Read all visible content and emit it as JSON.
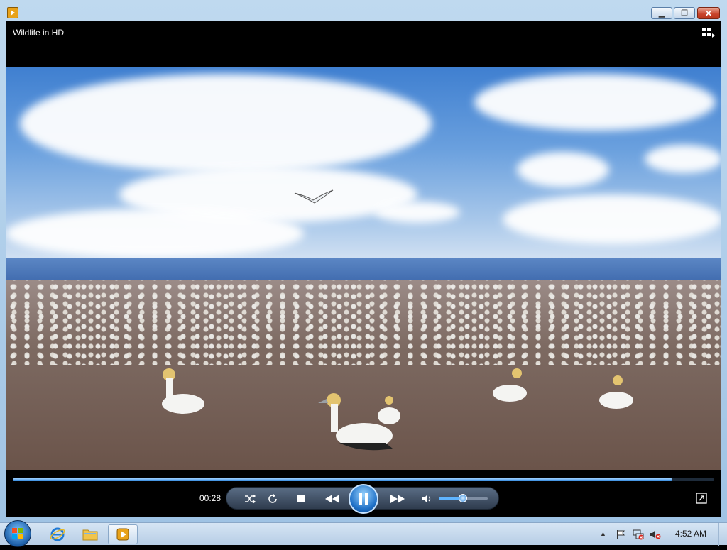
{
  "window": {
    "title": "",
    "video_title": "Wildlife in HD",
    "controls": {
      "time_elapsed": "00:28",
      "seek_progress": 0.94,
      "volume_level": 0.48,
      "state": "playing"
    }
  },
  "taskbar": {
    "clock": "4:52 AM",
    "pinned": [
      "internet-explorer",
      "windows-explorer",
      "windows-media-player"
    ]
  },
  "icons": {
    "app": "windows-media-player-icon",
    "switch_to_library": "switch-to-library-icon",
    "shuffle": "shuffle-icon",
    "repeat": "repeat-icon",
    "stop": "stop-icon",
    "previous": "rewind-icon",
    "pause": "pause-icon",
    "next": "fast-forward-icon",
    "volume": "speaker-icon",
    "fullscreen": "fullscreen-icon"
  },
  "colors": {
    "accent": "#1e6fc6",
    "close_button": "#c8432a"
  }
}
